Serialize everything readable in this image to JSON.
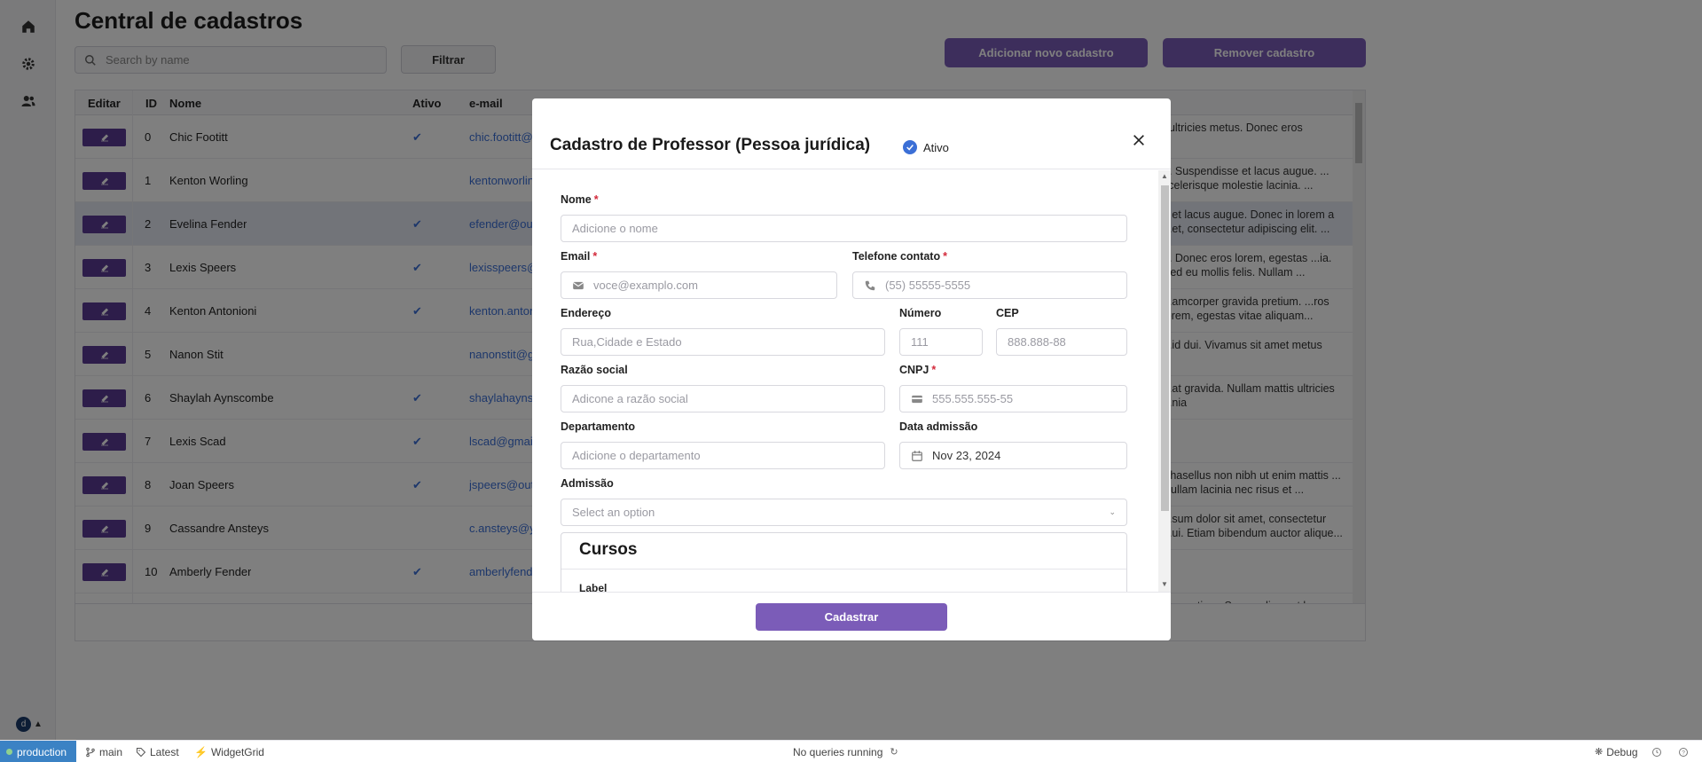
{
  "page": {
    "title": "Central de cadastros"
  },
  "toolbar": {
    "search_placeholder": "Search by name",
    "filter_label": "Filtrar",
    "add_label": "Adicionar novo cadastro",
    "remove_label": "Remover cadastro"
  },
  "grid": {
    "columns": [
      "Editar",
      "ID",
      "Nome",
      "Ativo",
      "e-mail"
    ],
    "rows": [
      {
        "id": "0",
        "name": "Chic Footitt",
        "active": true,
        "email": "chic.footitt@",
        "bio": ". ultricies metus. Donec eros",
        "selected": false
      },
      {
        "id": "1",
        "name": "Kenton Worling",
        "active": false,
        "email": "kentonworlin",
        "bio": "... Suspendisse et lacus augue. ... scelerisque molestie lacinia. ...",
        "selected": false
      },
      {
        "id": "2",
        "name": "Evelina Fender",
        "active": true,
        "email": "efender@out",
        "bio": "e et lacus augue. Donec in lorem a ...et, consectetur adipiscing elit. ...",
        "selected": true
      },
      {
        "id": "3",
        "name": "Lexis Speers",
        "active": true,
        "email": "lexisspeers@",
        "bio": "e. Donec eros lorem, egestas ...ia. Sed eu mollis felis. Nullam ...",
        "selected": false
      },
      {
        "id": "4",
        "name": "Kenton Antonioni",
        "active": true,
        "email": "kenton.anton",
        "bio": "...amcorper gravida pretium. ...ros lorem, egestas vitae aliquam...",
        "selected": false
      },
      {
        "id": "5",
        "name": "Nanon Stit",
        "active": false,
        "email": "nanonstit@g",
        "bio": "...id dui. Vivamus sit amet metus",
        "selected": false
      },
      {
        "id": "6",
        "name": "Shaylah Aynscombe",
        "active": true,
        "email": "shaylahayns",
        "bio": "...at gravida. Nullam mattis ultricies ...nia",
        "selected": false
      },
      {
        "id": "7",
        "name": "Lexis Scad",
        "active": true,
        "email": "lscad@gmail",
        "bio": "",
        "selected": false
      },
      {
        "id": "8",
        "name": "Joan Speers",
        "active": true,
        "email": "jspeers@out",
        "bio": "Phasellus non nibh ut enim mattis ... Nullam lacinia nec risus et ...",
        "selected": false
      },
      {
        "id": "9",
        "name": "Cassandre Ansteys",
        "active": false,
        "email": "c.ansteys@y",
        "bio": "...sum dolor sit amet, consectetur ...ui. Etiam bibendum auctor alique...",
        "selected": false
      },
      {
        "id": "10",
        "name": "Amberly Fender",
        "active": true,
        "email": "amberlyfend",
        "bio": "",
        "selected": false
      }
    ],
    "partial_row_bio": "...a pretium. Suspendisse et lacus"
  },
  "modal": {
    "title": "Cadastro de Professor (Pessoa jurídica)",
    "ativo_label": "Ativo",
    "fields": {
      "nome": {
        "label": "Nome",
        "placeholder": "Adicione o nome"
      },
      "email": {
        "label": "Email",
        "placeholder": "voce@examplo.com"
      },
      "telefone": {
        "label": "Telefone contato",
        "placeholder": "(55) 55555-5555"
      },
      "endereco": {
        "label": "Endereço",
        "placeholder": "Rua,Cidade e Estado"
      },
      "numero": {
        "label": "Número",
        "placeholder": "111"
      },
      "cep": {
        "label": "CEP",
        "placeholder": "888.888-88"
      },
      "razao": {
        "label": "Razão social",
        "placeholder": "Adicone a razão social"
      },
      "cnpj": {
        "label": "CNPJ",
        "placeholder": "555.555.555-55"
      },
      "departamento": {
        "label": "Departamento",
        "placeholder": "Adicione o departamento"
      },
      "data_admissao": {
        "label": "Data admissão",
        "value": "Nov 23, 2024"
      },
      "admissao": {
        "label": "Admissão",
        "placeholder": "Select an option"
      }
    },
    "cursos": {
      "title": "Cursos",
      "label": "Label"
    },
    "submit_label": "Cadastrar",
    "required_mark": "*"
  },
  "statusbar": {
    "env": "production",
    "branch": "main",
    "tag": "Latest",
    "widget": "WidgetGrid",
    "queries": "No queries running",
    "debug": "Debug",
    "user_initial": "d"
  },
  "colors": {
    "accent": "#7b5cb8",
    "edit_button": "#5b3a94",
    "link": "#3b6fd6",
    "required": "#d3293a",
    "env_badge": "#3b82c4"
  }
}
